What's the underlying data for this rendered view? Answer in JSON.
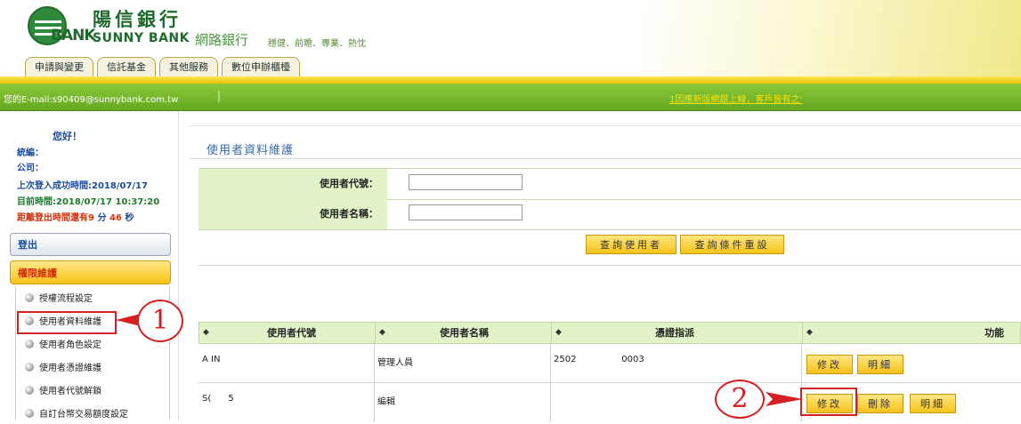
{
  "brand": {
    "logo_ank": "BANK",
    "name_cn": "陽信銀行",
    "name_en": "SUNNY BANK",
    "netbank": "網路銀行",
    "slogan": "穩健、前瞻、專業、熱忱"
  },
  "tabs": [
    "申請與變更",
    "信託基金",
    "其他服務",
    "數位申辦櫃檯"
  ],
  "topbar": {
    "email": "您的E-mail:s90409@sunnybank.com.tw",
    "separator": "|",
    "marquee": "1因應新版網銀上線，客戶皆有之'"
  },
  "sidebar": {
    "greeting": "您好！",
    "tax_id_label": "統編：",
    "company_label": "公司：",
    "last_login_label": "上次登入成功時間:",
    "last_login_value": "2018/07/17",
    "now_label": "目前時間:",
    "now_value": "2018/07/17 10:37:20",
    "logout_prefix": "距離登出時間還有",
    "logout_min": "9",
    "logout_min_unit": " 分 ",
    "logout_sec": "46",
    "logout_sec_unit": " 秒",
    "logout_button": "登出",
    "section": "權限維護",
    "items": [
      "授權流程設定",
      "使用者資料維護",
      "使用者角色設定",
      "使用者憑證維護",
      "使用者代號解鎖",
      "自訂台幣交易額度設定"
    ]
  },
  "annotations": {
    "one": "1",
    "two": "2"
  },
  "main": {
    "title": "使用者資料維護",
    "form": {
      "user_id_label": "使用者代號：",
      "user_name_label": "使用者名稱：",
      "user_id_value": "",
      "user_name_value": ""
    },
    "buttons": {
      "query": "查詢使用者",
      "reset": "查詢條件重設"
    },
    "table": {
      "sort_icon": "◆",
      "headers": [
        "使用者代號",
        "使用者名稱",
        "憑證指派",
        "功能"
      ],
      "rows": [
        {
          "id": "A    IN",
          "name": "管理人員",
          "cert": "2502                0003",
          "actions": [
            "修改",
            "明細"
          ]
        },
        {
          "id": "S(      5",
          "name": "編輯",
          "cert": "",
          "actions": [
            "修改",
            "刪除",
            "明細"
          ]
        }
      ]
    }
  }
}
